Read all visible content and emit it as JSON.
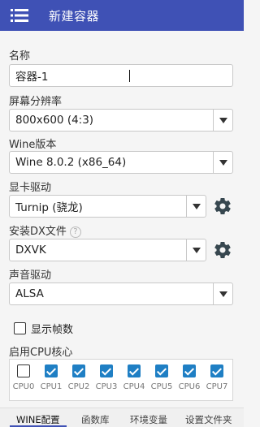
{
  "appbar": {
    "title": "新建容器",
    "menu_icon": "hamburger-menu-icon"
  },
  "form": {
    "name_label": "名称",
    "name_value": "容器-1",
    "resolution_label": "屏幕分辨率",
    "resolution_value": "800x600 (4:3)",
    "wine_label": "Wine版本",
    "wine_value": "Wine 8.0.2 (x86_64)",
    "gpu_label": "显卡驱动",
    "gpu_value": "Turnip (骁龙)",
    "dx_label": "安装DX文件",
    "dx_help": "?",
    "dx_value": "DXVK",
    "audio_label": "声音驱动",
    "audio_value": "ALSA",
    "show_fps_label": "显示帧数",
    "show_fps_checked": false,
    "cpu_label": "启用CPU核心"
  },
  "cpus": [
    {
      "label": "CPU0",
      "checked": false
    },
    {
      "label": "CPU1",
      "checked": true
    },
    {
      "label": "CPU2",
      "checked": true
    },
    {
      "label": "CPU3",
      "checked": true
    },
    {
      "label": "CPU4",
      "checked": true
    },
    {
      "label": "CPU5",
      "checked": true
    },
    {
      "label": "CPU6",
      "checked": true
    },
    {
      "label": "CPU7",
      "checked": true
    }
  ],
  "tabs": [
    {
      "label": "WINE配置",
      "active": true
    },
    {
      "label": "函数库",
      "active": false
    },
    {
      "label": "环境变量",
      "active": false
    },
    {
      "label": "设置文件夹",
      "active": false
    }
  ],
  "colors": {
    "appbar": "#3f51b5",
    "accent": "#1f7fc4"
  }
}
